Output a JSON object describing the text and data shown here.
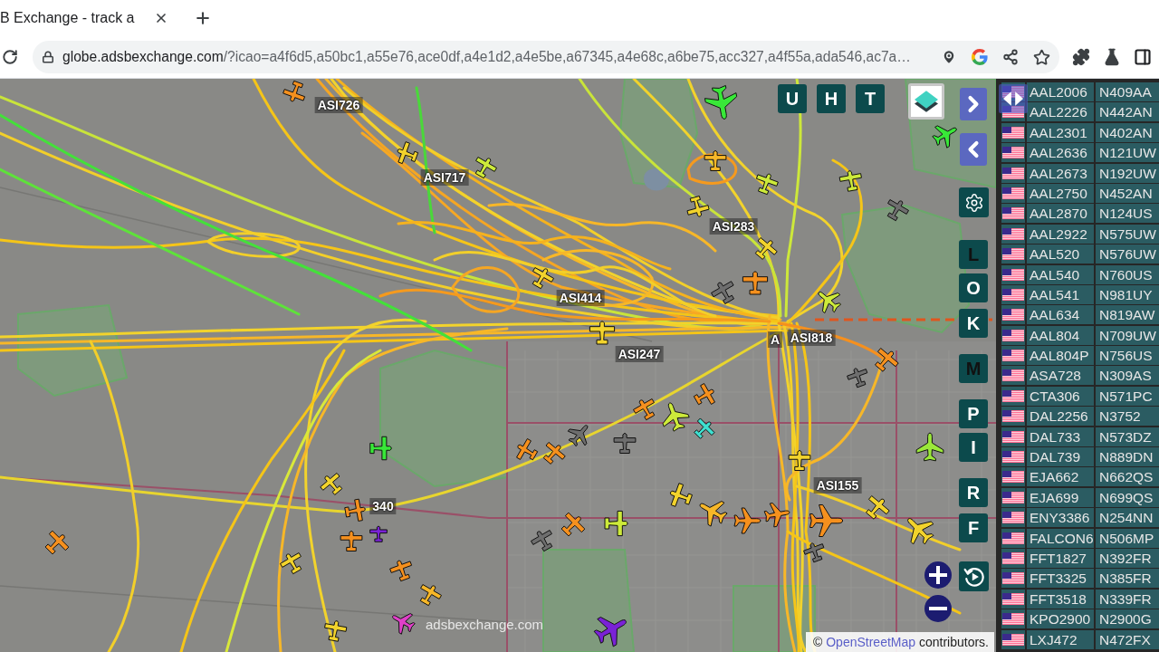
{
  "browser": {
    "tab": {
      "title": "B Exchange - track a"
    },
    "address": {
      "host": "globe.adsbexchange.com",
      "path": "/?icao=a4f6d5,a50bc1,a55e76,ace0df,a4e1d2,a4e5be,a67345,a4e68c,a6be75,acc327,a4f55a,ada546,ac7a…"
    }
  },
  "map": {
    "top_buttons": [
      {
        "label": "U",
        "active": true
      },
      {
        "label": "H",
        "active": true
      },
      {
        "label": "T",
        "active": true
      }
    ],
    "side_buttons": [
      {
        "label": "L",
        "active": false
      },
      {
        "label": "O",
        "active": true
      },
      {
        "label": "K",
        "active": true
      },
      {
        "label": "M",
        "active": false
      },
      {
        "label": "P",
        "active": true
      },
      {
        "label": "I",
        "active": true
      },
      {
        "label": "R",
        "active": true
      },
      {
        "label": "F",
        "active": true
      }
    ],
    "flight_labels": [
      "ASI726",
      "ASI717",
      "ASI283",
      "ASI414",
      "ASI247",
      "A",
      "ASI818",
      "ASI155",
      "340"
    ],
    "aircraft": [
      {
        "color": "#f5901e"
      },
      {
        "color": "#38e838"
      },
      {
        "color": "#f2d32c"
      },
      {
        "color": "#cdea3a"
      },
      {
        "color": "#f7b728"
      },
      {
        "color": "#cdea3a"
      },
      {
        "color": "#cdea3a"
      },
      {
        "color": "#6e6e6e"
      },
      {
        "color": "#f2d32c"
      },
      {
        "color": "#38e838"
      },
      {
        "color": "#f2d32c"
      },
      {
        "color": "#f2d32c"
      },
      {
        "color": "#cdea3a"
      },
      {
        "color": "#f5901e"
      },
      {
        "color": "#6e6e6e"
      },
      {
        "color": "#f2d32c"
      },
      {
        "color": "#f5901e"
      },
      {
        "color": "#6e6e6e"
      },
      {
        "color": "#f5901e"
      },
      {
        "color": "#cdea3a"
      },
      {
        "color": "#f5901e"
      },
      {
        "color": "#3fe0d0"
      },
      {
        "color": "#6e6e6e"
      },
      {
        "color": "#6e6e6e"
      },
      {
        "color": "#f5901e"
      },
      {
        "color": "#f5901e"
      },
      {
        "color": "#38e838"
      },
      {
        "color": "#f2d32c"
      },
      {
        "color": "#f5901e"
      },
      {
        "color": "#f5901e"
      },
      {
        "color": "#7a22d6"
      },
      {
        "color": "#f5901e"
      },
      {
        "color": "#f2d32c"
      },
      {
        "color": "#f5901e"
      },
      {
        "color": "#f7b728"
      },
      {
        "color": "#f2d32c"
      },
      {
        "color": "#e040c8"
      },
      {
        "color": "#7a22d6"
      },
      {
        "color": "#f5901e"
      },
      {
        "color": "#6e6e6e"
      },
      {
        "color": "#cdea3a"
      },
      {
        "color": "#f2d32c"
      },
      {
        "color": "#f7b728"
      },
      {
        "color": "#f5901e"
      },
      {
        "color": "#f5901e"
      },
      {
        "color": "#6e6e6e"
      },
      {
        "color": "#f5901e"
      },
      {
        "color": "#f2d32c"
      },
      {
        "color": "#f2d32c"
      },
      {
        "color": "#9be83a"
      },
      {
        "color": "#f2d32c"
      }
    ],
    "logo_text": "adsbexchange.com",
    "attribution": {
      "prefix": "©",
      "link": "OpenStreetMap",
      "suffix": "contributors."
    }
  },
  "aircraft_list": {
    "rows": [
      {
        "callsign": "AAL2006",
        "registration": "N409AA"
      },
      {
        "callsign": "AAL2226",
        "registration": "N442AN"
      },
      {
        "callsign": "AAL2301",
        "registration": "N402AN"
      },
      {
        "callsign": "AAL2636",
        "registration": "N121UW"
      },
      {
        "callsign": "AAL2673",
        "registration": "N192UW"
      },
      {
        "callsign": "AAL2750",
        "registration": "N452AN"
      },
      {
        "callsign": "AAL2870",
        "registration": "N124US"
      },
      {
        "callsign": "AAL2922",
        "registration": "N575UW"
      },
      {
        "callsign": "AAL520",
        "registration": "N576UW"
      },
      {
        "callsign": "AAL540",
        "registration": "N760US"
      },
      {
        "callsign": "AAL541",
        "registration": "N981UY"
      },
      {
        "callsign": "AAL634",
        "registration": "N819AW"
      },
      {
        "callsign": "AAL804",
        "registration": "N709UW"
      },
      {
        "callsign": "AAL804P",
        "registration": "N756US"
      },
      {
        "callsign": "ASA728",
        "registration": "N309AS"
      },
      {
        "callsign": "CTA306",
        "registration": "N571PC"
      },
      {
        "callsign": "DAL2256",
        "registration": "N3752"
      },
      {
        "callsign": "DAL733",
        "registration": "N573DZ"
      },
      {
        "callsign": "DAL739",
        "registration": "N889DN"
      },
      {
        "callsign": "EJA662",
        "registration": "N662QS"
      },
      {
        "callsign": "EJA699",
        "registration": "N699QS"
      },
      {
        "callsign": "ENY3386",
        "registration": "N254NN"
      },
      {
        "callsign": "FALCON6",
        "registration": "N506MP"
      },
      {
        "callsign": "FFT1827",
        "registration": "N392FR"
      },
      {
        "callsign": "FFT3325",
        "registration": "N385FR"
      },
      {
        "callsign": "FFT3518",
        "registration": "N339FR"
      },
      {
        "callsign": "KPO2900",
        "registration": "N2900G"
      },
      {
        "callsign": "LXJ472",
        "registration": "N472FX"
      }
    ]
  }
}
